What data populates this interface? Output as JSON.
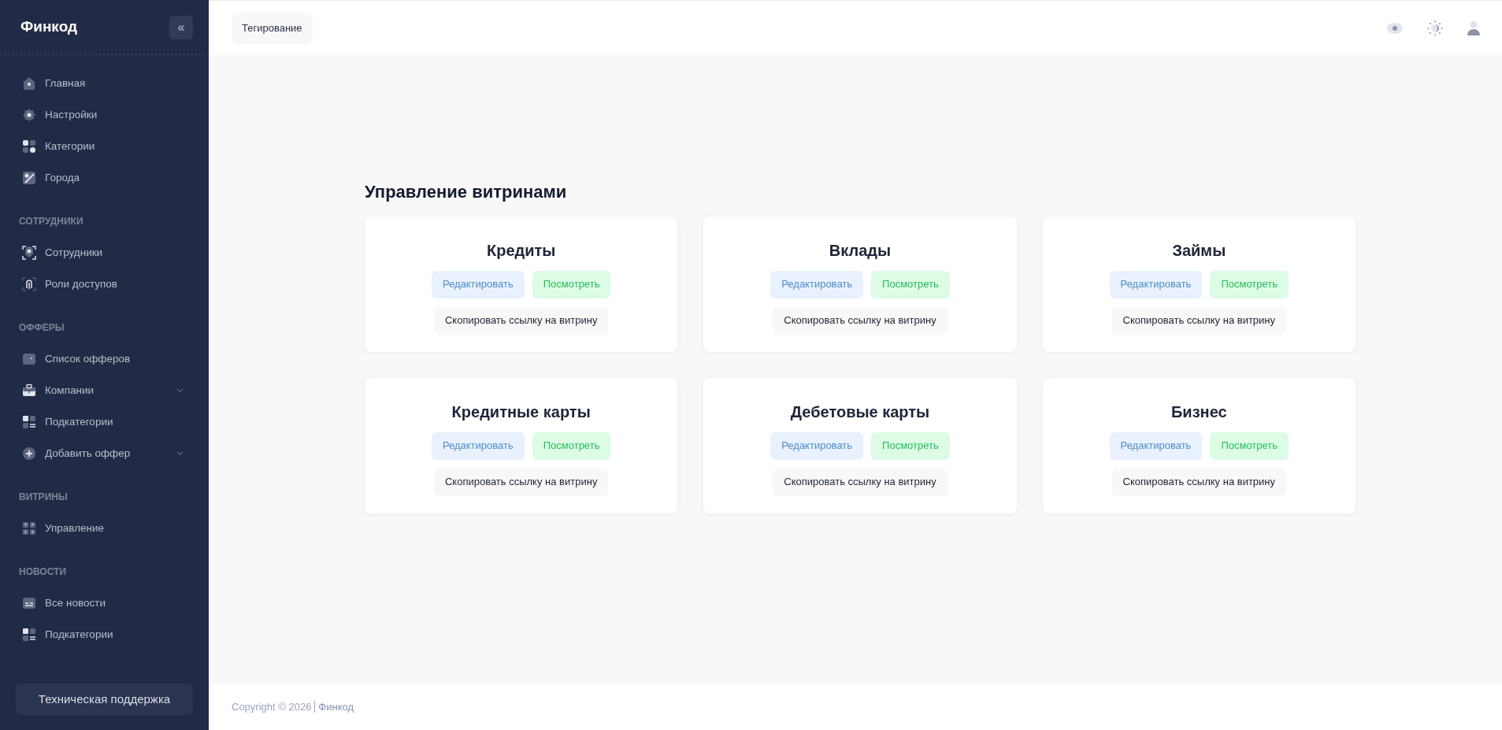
{
  "sidebar": {
    "logo": "Финкод",
    "collapse_button": "«",
    "sections": [
      {
        "items": [
          {
            "label": "Главная",
            "kind": "link"
          },
          {
            "label": "Настройки",
            "kind": "link"
          },
          {
            "label": "Категории",
            "kind": "link"
          },
          {
            "label": "Города",
            "kind": "link"
          }
        ]
      },
      {
        "title": "СОТРУДНИКИ",
        "items": [
          {
            "label": "Сотрудники",
            "kind": "link"
          },
          {
            "label": "Роли доступов",
            "kind": "link"
          }
        ]
      },
      {
        "title": "ОФФЕРЫ",
        "items": [
          {
            "label": "Список офферов",
            "kind": "link"
          },
          {
            "label": "Компании",
            "kind": "dropdown"
          },
          {
            "label": "Подкатегории",
            "kind": "link"
          },
          {
            "label": "Добавить оффер",
            "kind": "dropdown"
          }
        ]
      },
      {
        "title": "ВИТРИНЫ",
        "items": [
          {
            "label": "Управление",
            "kind": "link"
          }
        ]
      },
      {
        "title": "НОВОСТИ",
        "items": [
          {
            "label": "Все новости",
            "kind": "link"
          },
          {
            "label": "Подкатегории",
            "kind": "link"
          }
        ]
      }
    ],
    "support_button": "Техническая поддержка"
  },
  "header": {
    "tag_button": "Тегирование"
  },
  "main": {
    "title": "Управление витринами",
    "cards": [
      {
        "title": "Кредиты",
        "edit": "Редактировать",
        "view": "Посмотреть",
        "copy": "Скопировать ссылку на витрину"
      },
      {
        "title": "Вклады",
        "edit": "Редактировать",
        "view": "Посмотреть",
        "copy": "Скопировать ссылку на витрину"
      },
      {
        "title": "Займы",
        "edit": "Редактировать",
        "view": "Посмотреть",
        "copy": "Скопировать ссылку на витрину"
      },
      {
        "title": "Кредитные карты",
        "edit": "Редактировать",
        "view": "Посмотреть",
        "copy": "Скопировать ссылку на витрину"
      },
      {
        "title": "Дебетовые карты",
        "edit": "Редактировать",
        "view": "Посмотреть",
        "copy": "Скопировать ссылку на витрину"
      },
      {
        "title": "Бизнес",
        "edit": "Редактировать",
        "view": "Посмотреть",
        "copy": "Скопировать ссылку на витрину"
      }
    ]
  },
  "footer": {
    "copyright": "Copyright © 2026",
    "link": "Финкод"
  }
}
